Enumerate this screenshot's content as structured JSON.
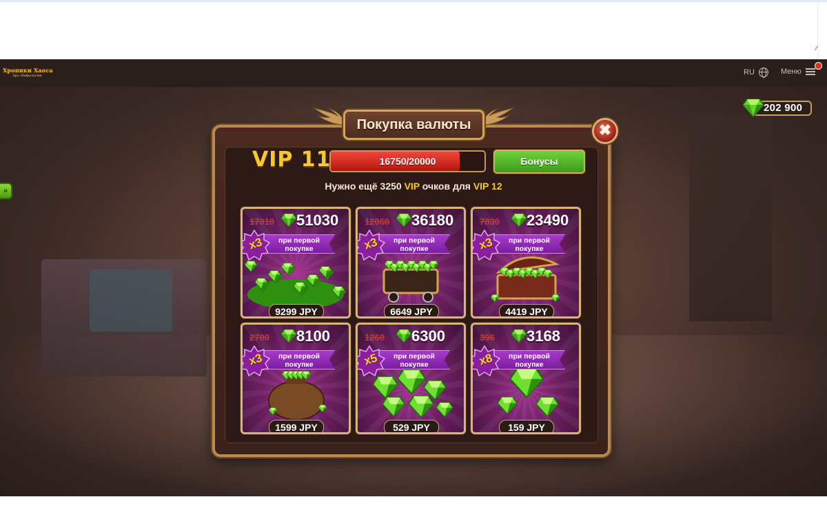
{
  "header": {
    "logo_line1": "Хроники Хаоса",
    "logo_line2": "Эра Мифологии",
    "language": "RU",
    "menu_label": "Меню"
  },
  "game": {
    "gem_balance": "202 900",
    "dialog": {
      "title": "Покупка валюты",
      "close_label": "✖",
      "vip": {
        "level_label": "VIP 11",
        "progress_text": "16750/20000",
        "progress_current": 16750,
        "progress_max": 20000,
        "bonus_button": "Бонусы",
        "hint_prefix": "Нужно ещё 3250",
        "hint_vip1": "VIP",
        "hint_middle": "очков для",
        "hint_vip2": "VIP 12"
      },
      "offers": [
        {
          "old": "17010",
          "amount": "51030",
          "mult": "x3",
          "note_line1": "при первой",
          "note_line2": "покупке",
          "price": "9299 JPY",
          "art": "gem-pile-icon"
        },
        {
          "old": "12060",
          "amount": "36180",
          "mult": "x3",
          "note_line1": "при первой",
          "note_line2": "покупке",
          "price": "6649 JPY",
          "art": "gem-cart-icon"
        },
        {
          "old": "7830",
          "amount": "23490",
          "mult": "x3",
          "note_line1": "при первой",
          "note_line2": "покупке",
          "price": "4419 JPY",
          "art": "gem-chest-icon"
        },
        {
          "old": "2700",
          "amount": "8100",
          "mult": "x3",
          "note_line1": "при первой",
          "note_line2": "покупке",
          "price": "1599 JPY",
          "art": "gem-bag-icon"
        },
        {
          "old": "1260",
          "amount": "6300",
          "mult": "x5",
          "note_line1": "при первой",
          "note_line2": "покупке",
          "price": "529 JPY",
          "art": "gem-cluster-icon"
        },
        {
          "old": "396",
          "amount": "3168",
          "mult": "x8",
          "note_line1": "при первой",
          "note_line2": "покупке",
          "price": "159 JPY",
          "art": "gem-pair-icon"
        }
      ]
    }
  },
  "colors": {
    "gem_green": "#5fd42a",
    "vip_gold": "#f7c832",
    "bar_red": "#e23b2e",
    "button_green": "#4fb023",
    "card_purple": "#8a2a7a"
  }
}
